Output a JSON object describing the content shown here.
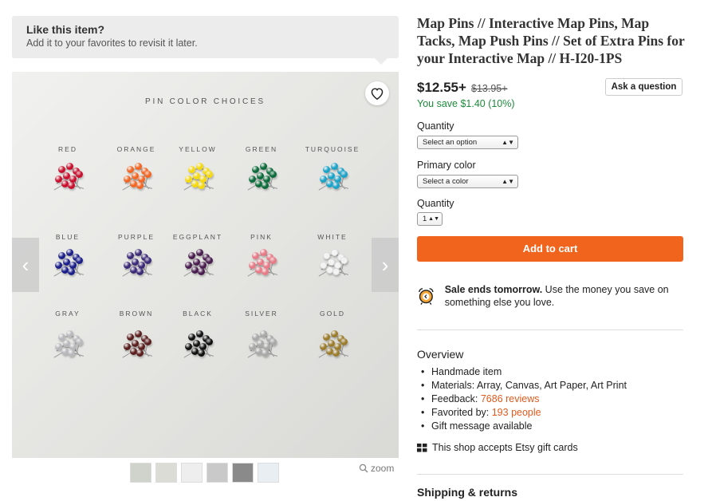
{
  "tooltip": {
    "title": "Like this item?",
    "subtitle": "Add it to your favorites to revisit it later."
  },
  "photo": {
    "heading": "PIN COLOR CHOICES",
    "colors": [
      "RED",
      "ORANGE",
      "YELLOW",
      "GREEN",
      "TURQUOISE",
      "BLUE",
      "PURPLE",
      "EGGPLANT",
      "PINK",
      "WHITE",
      "GRAY",
      "BROWN",
      "BLACK",
      "SILVER",
      "GOLD"
    ],
    "pin_hex": [
      "#c8102e",
      "#f26522",
      "#f5d90a",
      "#0b6b3a",
      "#1aa3c9",
      "#1b1e8a",
      "#3b2a78",
      "#4a1d4f",
      "#e87a86",
      "#f4f4f4",
      "#b8b8bc",
      "#5a1e1e",
      "#111111",
      "#a8a8a8",
      "#9b7c2c"
    ]
  },
  "zoom_label": "zoom",
  "product": {
    "title": "Map Pins // Interactive Map Pins, Map Tacks, Map Push Pins // Set of Extra Pins for your Interactive Map // H-I20-1PS",
    "price": "$12.55+",
    "old_price": "$13.95+",
    "savings": "You save $1.40 (10%)",
    "ask_button": "Ask a question",
    "quantity_label": "Quantity",
    "quantity_select": "Select an option",
    "color_label": "Primary color",
    "color_select": "Select a color",
    "quantity2_label": "Quantity",
    "quantity_value": "1",
    "add_to_cart": "Add to cart",
    "sale_bold": "Sale ends tomorrow.",
    "sale_rest": " Use the money you save on something else you love.",
    "overview_title": "Overview",
    "overview": {
      "handmade": "Handmade item",
      "materials": "Materials: Array, Canvas, Art Paper, Art Print",
      "feedback_label": "Feedback: ",
      "feedback_link": "7686 reviews",
      "favorited_label": "Favorited by: ",
      "favorited_link": "193 people",
      "gift_message": "Gift message available"
    },
    "gift_cards": "This shop accepts Etsy gift cards",
    "shipping_title": "Shipping & returns"
  },
  "colors": {
    "accent": "#f1641e",
    "savings": "#1c8a3a",
    "link": "#e05a1f"
  }
}
